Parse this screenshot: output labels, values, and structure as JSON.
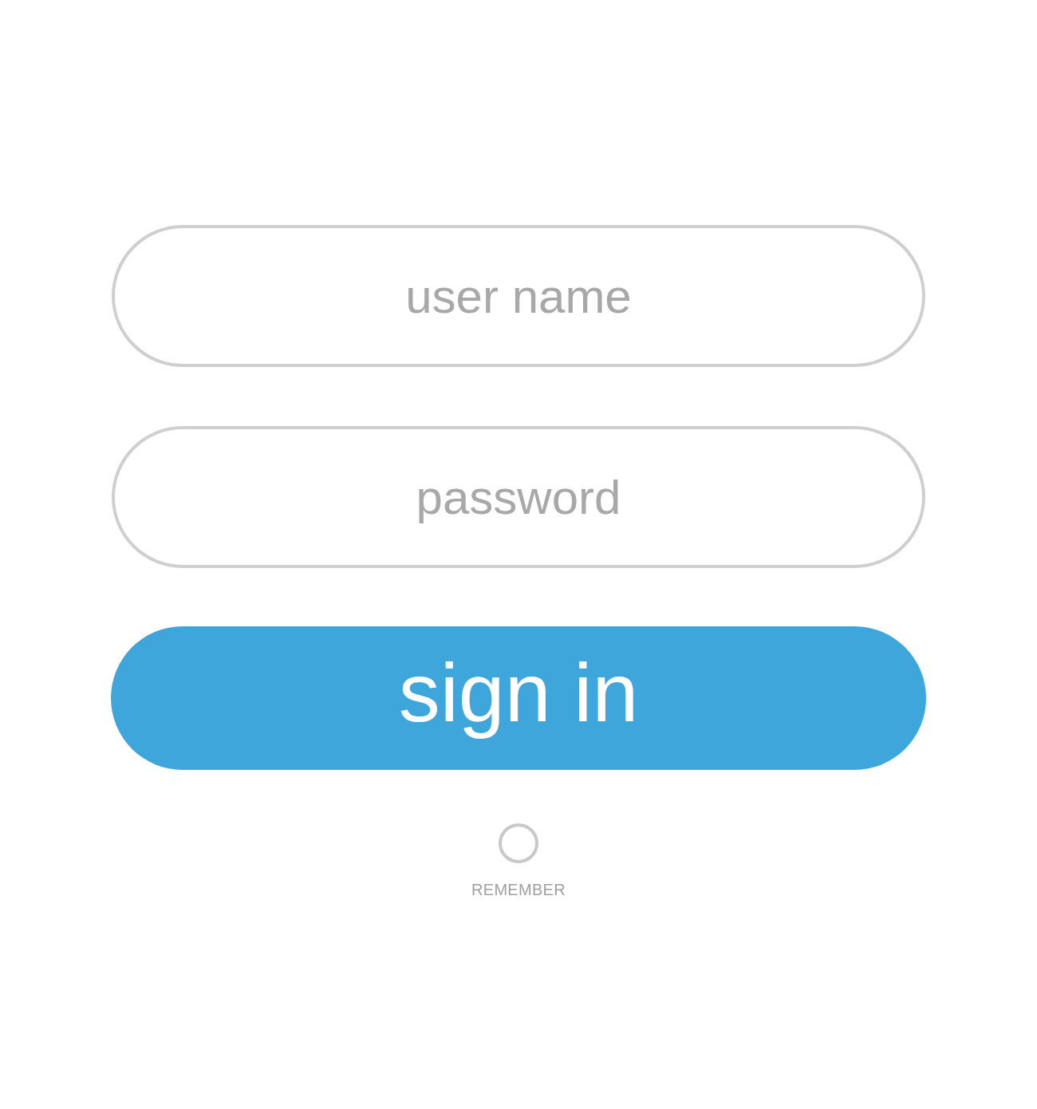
{
  "login_form": {
    "fields": [
      {
        "placeholder": "user name"
      },
      {
        "placeholder": "password"
      }
    ],
    "submit_button": {
      "label": "sign in"
    },
    "remember_option": {
      "label": "REMEMBER",
      "checked": false
    }
  }
}
